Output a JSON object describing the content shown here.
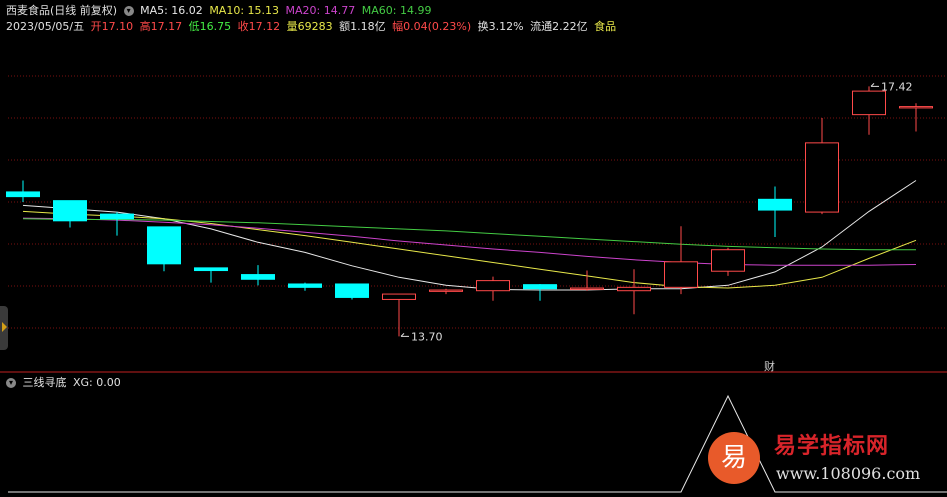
{
  "header": {
    "stock_title": "西麦食品(日线 前复权)",
    "ma5": "MA5: 16.02",
    "ma10": "MA10: 15.13",
    "ma20": "MA20: 14.77",
    "ma60": "MA60: 14.99",
    "date": "2023/05/05/五",
    "open": "开17.10",
    "high": "高17.17",
    "low": "低16.75",
    "close": "收17.12",
    "volume": "量69283",
    "amount": "额1.18亿",
    "change": "幅0.04(0.23%)",
    "turnover": "换3.12%",
    "float": "流通2.22亿",
    "sector": "食品"
  },
  "colors": {
    "up": "#ff4a4a",
    "down": "#00ffff",
    "ma5": "#e8e8e8",
    "ma10": "#e8e84a",
    "ma20": "#cc44cc",
    "ma60": "#44cc44",
    "grid": "#7a1010",
    "divider": "#c02020"
  },
  "annotations": {
    "high_label": "17.42",
    "low_label": "13.70",
    "finance_marker": "财"
  },
  "subchart": {
    "title": "三线寻底",
    "xg": "XG: 0.00"
  },
  "watermark": {
    "logo_char": "易",
    "title": "易学指标网",
    "url": "www.108096.com"
  },
  "chart_data": {
    "type": "candlestick",
    "title": "西麦食品(日线 前复权)",
    "ylim": [
      13.2,
      18.2
    ],
    "candles": [
      {
        "o": 15.85,
        "h": 16.02,
        "l": 15.7,
        "c": 15.78
      },
      {
        "o": 15.72,
        "h": 15.72,
        "l": 15.32,
        "c": 15.42
      },
      {
        "o": 15.52,
        "h": 15.55,
        "l": 15.2,
        "c": 15.45
      },
      {
        "o": 15.33,
        "h": 15.33,
        "l": 14.67,
        "c": 14.78
      },
      {
        "o": 14.72,
        "h": 14.72,
        "l": 14.5,
        "c": 14.68
      },
      {
        "o": 14.62,
        "h": 14.76,
        "l": 14.46,
        "c": 14.55
      },
      {
        "o": 14.48,
        "h": 14.5,
        "l": 14.38,
        "c": 14.43
      },
      {
        "o": 14.48,
        "h": 14.48,
        "l": 14.25,
        "c": 14.28
      },
      {
        "o": 14.25,
        "h": 14.31,
        "l": 13.7,
        "c": 14.33
      },
      {
        "o": 14.37,
        "h": 14.41,
        "l": 14.33,
        "c": 14.39
      },
      {
        "o": 14.38,
        "h": 14.59,
        "l": 14.23,
        "c": 14.53
      },
      {
        "o": 14.47,
        "h": 14.48,
        "l": 14.23,
        "c": 14.41
      },
      {
        "o": 14.4,
        "h": 14.68,
        "l": 14.38,
        "c": 14.42
      },
      {
        "o": 14.38,
        "h": 14.7,
        "l": 14.03,
        "c": 14.43
      },
      {
        "o": 14.43,
        "h": 15.34,
        "l": 14.33,
        "c": 14.81
      },
      {
        "o": 14.67,
        "h": 15.02,
        "l": 14.6,
        "c": 14.99
      },
      {
        "o": 15.74,
        "h": 15.93,
        "l": 15.18,
        "c": 15.58
      },
      {
        "o": 15.55,
        "h": 16.95,
        "l": 15.52,
        "c": 16.58
      },
      {
        "o": 17.0,
        "h": 17.42,
        "l": 16.7,
        "c": 17.35
      },
      {
        "o": 17.1,
        "h": 17.17,
        "l": 16.75,
        "c": 17.12
      }
    ],
    "series": [
      {
        "name": "MA5",
        "values": [
          15.65,
          15.6,
          15.55,
          15.45,
          15.3,
          15.1,
          14.95,
          14.75,
          14.58,
          14.46,
          14.4,
          14.39,
          14.39,
          14.41,
          14.41,
          14.46,
          14.66,
          15.03,
          15.56,
          16.02
        ]
      },
      {
        "name": "MA10",
        "values": [
          15.56,
          15.52,
          15.49,
          15.45,
          15.38,
          15.29,
          15.2,
          15.1,
          15.0,
          14.9,
          14.8,
          14.7,
          14.6,
          14.5,
          14.44,
          14.42,
          14.46,
          14.58,
          14.86,
          15.13
        ]
      },
      {
        "name": "MA20",
        "values": [
          15.46,
          15.45,
          15.43,
          15.4,
          15.36,
          15.31,
          15.25,
          15.19,
          15.12,
          15.06,
          15.0,
          14.95,
          14.89,
          14.84,
          14.8,
          14.77,
          14.76,
          14.76,
          14.76,
          14.77
        ]
      },
      {
        "name": "MA60",
        "values": [
          15.45,
          15.44,
          15.44,
          15.43,
          15.41,
          15.39,
          15.36,
          15.33,
          15.3,
          15.27,
          15.23,
          15.19,
          15.15,
          15.11,
          15.07,
          15.04,
          15.02,
          15.0,
          14.99,
          14.99
        ]
      }
    ],
    "xg": [
      0,
      0,
      0,
      0,
      0,
      0,
      0,
      0,
      0,
      0,
      0,
      0,
      0,
      0,
      0,
      1,
      0,
      0,
      0,
      0
    ]
  }
}
